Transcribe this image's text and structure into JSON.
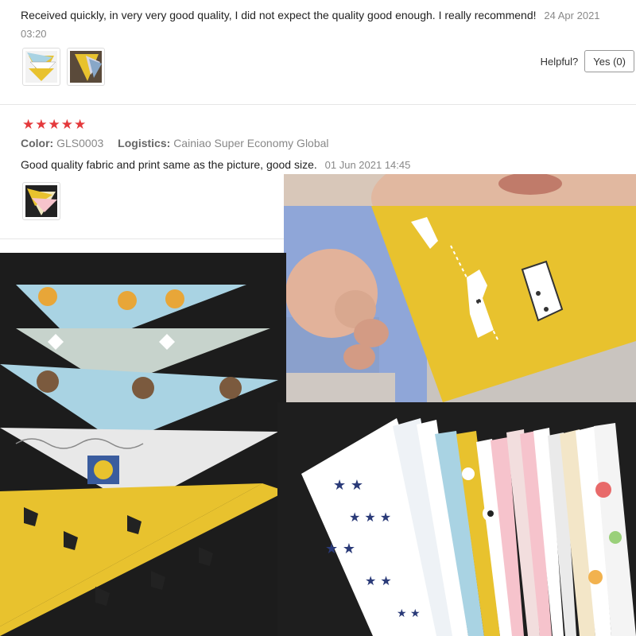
{
  "review1": {
    "text": "Received quickly, in very very good quality, I did not expect the quality good enough. I really recommend!",
    "date": "24 Apr 2021 03:20"
  },
  "helpful": {
    "label": "Helpful?",
    "yes_button": "Yes (0)"
  },
  "review2": {
    "rating": 5,
    "color_label": "Color:",
    "color_value": "GLS0003",
    "logistics_label": "Logistics:",
    "logistics_value": "Cainiao Super Economy Global",
    "text": "Good quality fabric and print same as the picture, good size.",
    "date": "01 Jun 2021 14:45"
  },
  "colors": {
    "star": "#e4393c",
    "divider": "#e6e6e6",
    "bib_yellow": "#e8c22e",
    "bib_light_blue": "#a9d3e3",
    "dark_bg": "#1c1c1c"
  }
}
